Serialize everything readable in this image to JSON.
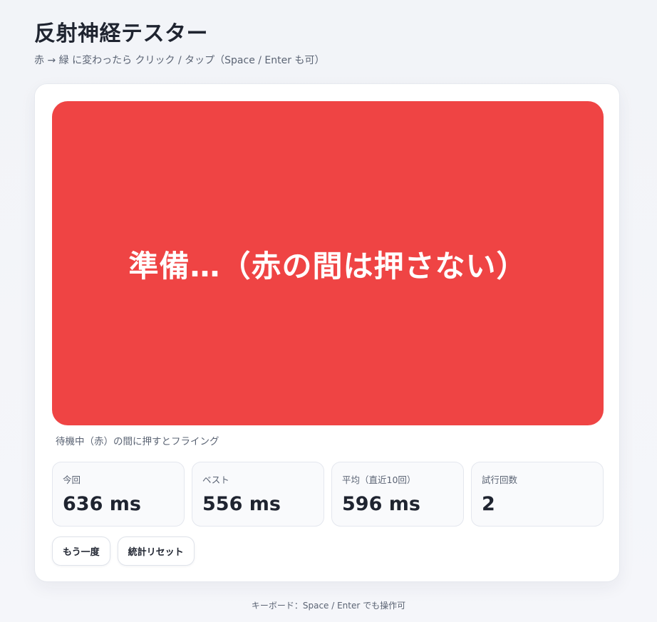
{
  "header": {
    "title": "反射神経テスター",
    "subtitle": "赤 → 緑 に変わったら クリック / タップ（Space / Enter も可）"
  },
  "stimulus": {
    "state": "red",
    "color": "#ef4444",
    "text": "準備…（赤の間は押さない）"
  },
  "hint": "待機中（赤）の間に押すとフライング",
  "stats": [
    {
      "label": "今回",
      "value": "636 ms"
    },
    {
      "label": "ベスト",
      "value": "556 ms"
    },
    {
      "label": "平均（直近10回）",
      "value": "596 ms"
    },
    {
      "label": "試行回数",
      "value": "2"
    }
  ],
  "buttons": {
    "retry_label": "もう一度",
    "reset_label": "統計リセット"
  },
  "footer": "キーボード：Space / Enter でも操作可"
}
